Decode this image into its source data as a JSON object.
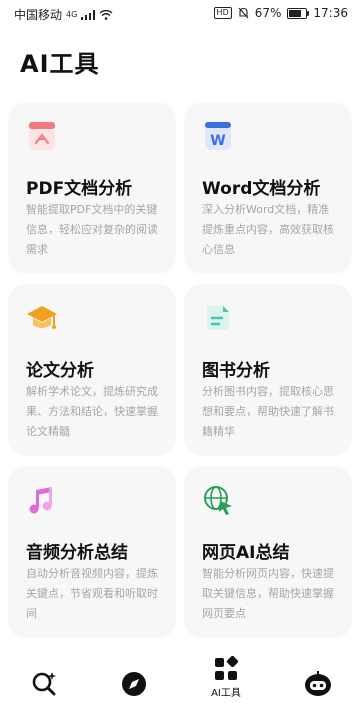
{
  "status_bar": {
    "carrier": "中国移动",
    "network": "4G",
    "hd": "HD",
    "battery": "67%",
    "time": "17:36"
  },
  "page": {
    "title": "AI工具"
  },
  "cards": [
    {
      "title": "PDF文档分析",
      "desc": "智能提取PDF文档中的关键信息，轻松应对复杂的阅读需求",
      "icon": "pdf-icon"
    },
    {
      "title": "Word文档分析",
      "desc": "深入分析Word文档，精准提炼重点内容，高效获取核心信息",
      "icon": "word-icon"
    },
    {
      "title": "论文分析",
      "desc": "解析学术论文，提炼研究成果、方法和结论，快速掌握论文精髓",
      "icon": "graduation-cap-icon"
    },
    {
      "title": "图书分析",
      "desc": "分析图书内容，提取核心思想和要点，帮助快速了解书籍精华",
      "icon": "document-icon"
    },
    {
      "title": "音频分析总结",
      "desc": "自动分析音视频内容，提炼关键点，节省观看和听取时间",
      "icon": "music-note-icon"
    },
    {
      "title": "网页AI总结",
      "desc": "智能分析网页内容，快速提取关键信息，帮助快速掌握网页要点",
      "icon": "web-cursor-icon"
    }
  ],
  "bottom_nav": {
    "items": [
      {
        "icon": "search-sparkle-icon",
        "label": ""
      },
      {
        "icon": "compass-icon",
        "label": ""
      },
      {
        "icon": "apps-grid-icon",
        "label": "AI工具"
      },
      {
        "icon": "robot-avatar-icon",
        "label": ""
      }
    ]
  },
  "colors": {
    "card_bg": "#f7f7f8",
    "desc_text": "#a6a6a6",
    "pdf": "#f07b7b",
    "word": "#3b6fe0",
    "cap": "#f2a021",
    "book": "#4cc4b0",
    "music": "#e06bd6",
    "web": "#27a055"
  }
}
